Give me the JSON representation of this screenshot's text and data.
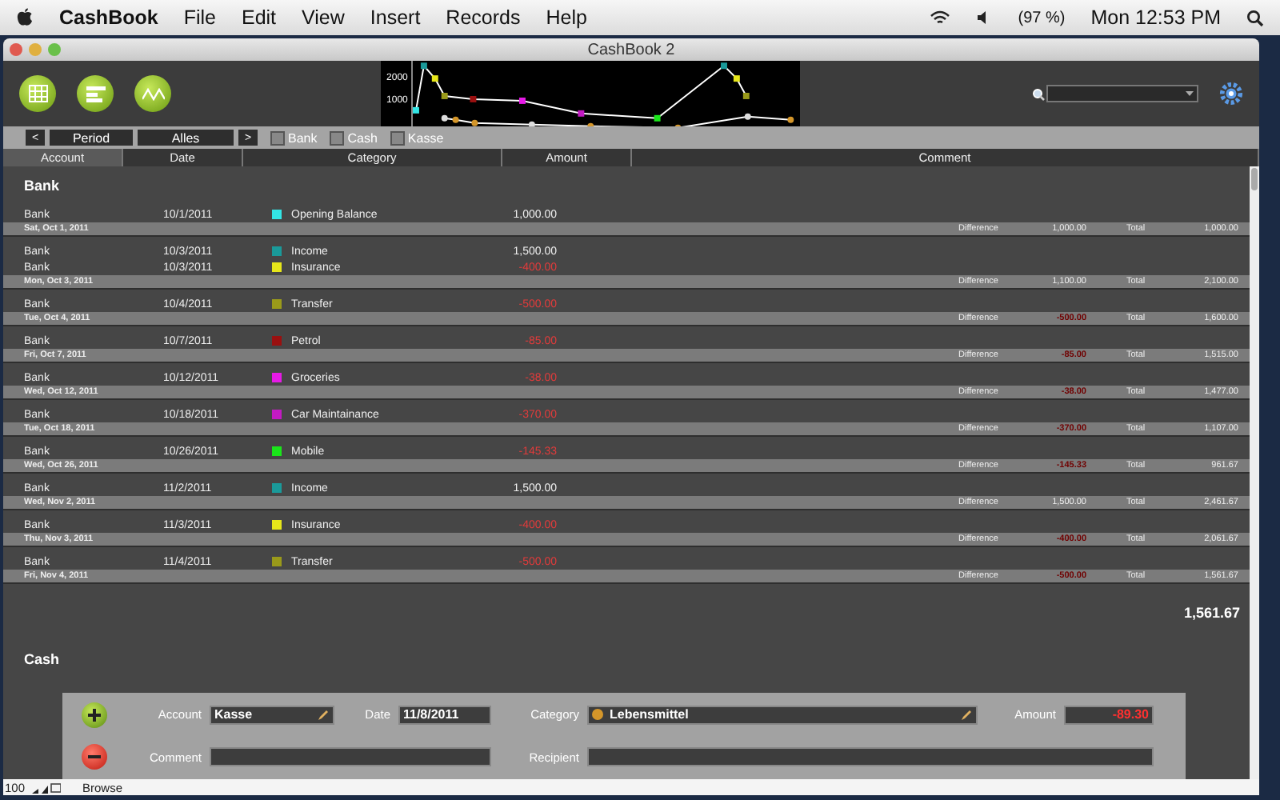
{
  "menu_bar": {
    "app": "CashBook",
    "items": [
      "File",
      "Edit",
      "View",
      "Insert",
      "Records",
      "Help"
    ],
    "battery": "(97 %)",
    "clock": "Mon 12:53 PM"
  },
  "window": {
    "title": "CashBook 2"
  },
  "toolbar": {
    "chart_axis_labels": [
      "2000",
      "1000"
    ]
  },
  "filter_bar": {
    "prev": "<",
    "period": "Period",
    "value": "Alles",
    "next": ">",
    "checkboxes": [
      {
        "label": "Bank",
        "checked": false
      },
      {
        "label": "Cash",
        "checked": false
      },
      {
        "label": "Kasse",
        "checked": false
      }
    ]
  },
  "columns": [
    {
      "label": "Account",
      "selected": true
    },
    {
      "label": "Date",
      "selected": false
    },
    {
      "label": "Category",
      "selected": false
    },
    {
      "label": "Amount",
      "selected": false
    },
    {
      "label": "Comment",
      "selected": false
    }
  ],
  "sections": [
    {
      "title": "Bank",
      "balance": "1,561.67",
      "groups": [
        {
          "day": "Sat, Oct 1, 2011",
          "difference_label": "Difference",
          "difference": "1,000.00",
          "difference_negative": false,
          "total_label": "Total",
          "total": "1,000.00",
          "rows": [
            {
              "account": "Bank",
              "date": "10/1/2011",
              "category": "Opening Balance",
              "color": "#33e6e6",
              "amount": "1,000.00",
              "negative": false
            }
          ]
        },
        {
          "day": "Mon, Oct 3, 2011",
          "difference_label": "Difference",
          "difference": "1,100.00",
          "difference_negative": false,
          "total_label": "Total",
          "total": "2,100.00",
          "rows": [
            {
              "account": "Bank",
              "date": "10/3/2011",
              "category": "Income",
              "color": "#1a9a9a",
              "amount": "1,500.00",
              "negative": false
            },
            {
              "account": "Bank",
              "date": "10/3/2011",
              "category": "Insurance",
              "color": "#e6e61a",
              "amount": "-400.00",
              "negative": true
            }
          ]
        },
        {
          "day": "Tue, Oct 4, 2011",
          "difference_label": "Difference",
          "difference": "-500.00",
          "difference_negative": true,
          "total_label": "Total",
          "total": "1,600.00",
          "rows": [
            {
              "account": "Bank",
              "date": "10/4/2011",
              "category": "Transfer",
              "color": "#9a9a1a",
              "amount": "-500.00",
              "negative": true
            }
          ]
        },
        {
          "day": "Fri, Oct 7, 2011",
          "difference_label": "Difference",
          "difference": "-85.00",
          "difference_negative": true,
          "total_label": "Total",
          "total": "1,515.00",
          "rows": [
            {
              "account": "Bank",
              "date": "10/7/2011",
              "category": "Petrol",
              "color": "#9a1010",
              "amount": "-85.00",
              "negative": true
            }
          ]
        },
        {
          "day": "Wed, Oct 12, 2011",
          "difference_label": "Difference",
          "difference": "-38.00",
          "difference_negative": true,
          "total_label": "Total",
          "total": "1,477.00",
          "rows": [
            {
              "account": "Bank",
              "date": "10/12/2011",
              "category": "Groceries",
              "color": "#e61ae6",
              "amount": "-38.00",
              "negative": true
            }
          ]
        },
        {
          "day": "Tue, Oct 18, 2011",
          "difference_label": "Difference",
          "difference": "-370.00",
          "difference_negative": true,
          "total_label": "Total",
          "total": "1,107.00",
          "rows": [
            {
              "account": "Bank",
              "date": "10/18/2011",
              "category": "Car Maintainance",
              "color": "#c31ac3",
              "amount": "-370.00",
              "negative": true
            }
          ]
        },
        {
          "day": "Wed, Oct 26, 2011",
          "difference_label": "Difference",
          "difference": "-145.33",
          "difference_negative": true,
          "total_label": "Total",
          "total": "961.67",
          "rows": [
            {
              "account": "Bank",
              "date": "10/26/2011",
              "category": "Mobile",
              "color": "#1ae61a",
              "amount": "-145.33",
              "negative": true
            }
          ]
        },
        {
          "day": "Wed, Nov 2, 2011",
          "difference_label": "Difference",
          "difference": "1,500.00",
          "difference_negative": false,
          "total_label": "Total",
          "total": "2,461.67",
          "rows": [
            {
              "account": "Bank",
              "date": "11/2/2011",
              "category": "Income",
              "color": "#1a9a9a",
              "amount": "1,500.00",
              "negative": false
            }
          ]
        },
        {
          "day": "Thu, Nov 3, 2011",
          "difference_label": "Difference",
          "difference": "-400.00",
          "difference_negative": true,
          "total_label": "Total",
          "total": "2,061.67",
          "rows": [
            {
              "account": "Bank",
              "date": "11/3/2011",
              "category": "Insurance",
              "color": "#e6e61a",
              "amount": "-400.00",
              "negative": true
            }
          ]
        },
        {
          "day": "Fri, Nov 4, 2011",
          "difference_label": "Difference",
          "difference": "-500.00",
          "difference_negative": true,
          "total_label": "Total",
          "total": "1,561.67",
          "rows": [
            {
              "account": "Bank",
              "date": "11/4/2011",
              "category": "Transfer",
              "color": "#9a9a1a",
              "amount": "-500.00",
              "negative": true
            }
          ]
        }
      ]
    },
    {
      "title": "Cash"
    }
  ],
  "form": {
    "account_label": "Account",
    "account": "Kasse",
    "date_label": "Date",
    "date": "11/8/2011",
    "category_label": "Category",
    "category": {
      "text": "Lebensmittel",
      "color": "#d4962a"
    },
    "amount_label": "Amount",
    "amount": "-89.30",
    "amount_negative": true,
    "comment_label": "Comment",
    "recipient_label": "Recipient"
  },
  "status_bar": {
    "zoom": "100",
    "mode": "Browse"
  }
}
